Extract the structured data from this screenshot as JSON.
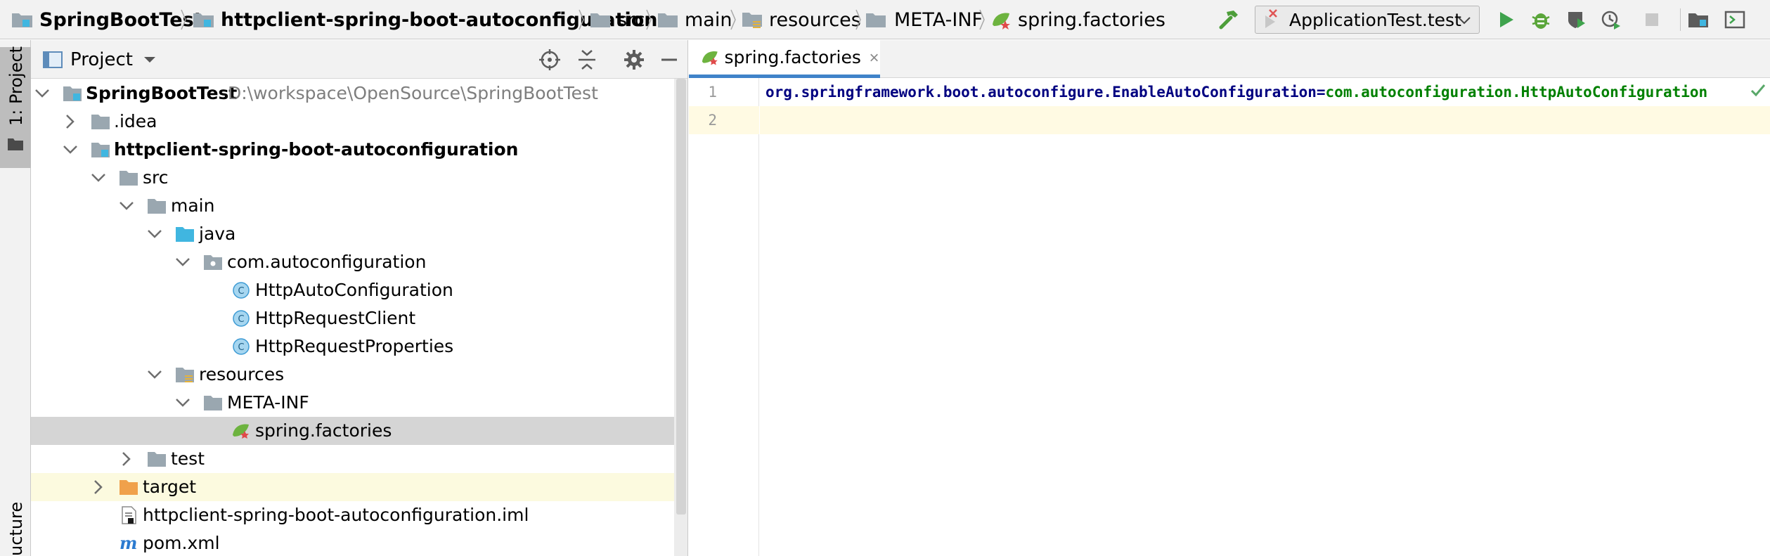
{
  "navbar": {
    "breadcrumbs": [
      {
        "label": "SpringBootTest",
        "icon": "folder-module-icon",
        "bold": true
      },
      {
        "label": "httpclient-spring-boot-autoconfiguration",
        "icon": "folder-module-icon",
        "bold": true
      },
      {
        "label": "src",
        "icon": "folder-icon"
      },
      {
        "label": "main",
        "icon": "folder-icon"
      },
      {
        "label": "resources",
        "icon": "resources-folder-icon"
      },
      {
        "label": "META-INF",
        "icon": "folder-icon"
      },
      {
        "label": "spring.factories",
        "icon": "spring-factories-icon"
      }
    ],
    "run_config": "ApplicationTest.test",
    "toolbar_icons": [
      "build-hammer-icon",
      "run-icon",
      "debug-icon",
      "coverage-icon",
      "profile-icon",
      "stop-icon",
      "project-structure-icon",
      "terminal-icon"
    ]
  },
  "left_strip": {
    "project_tab": "1: Project",
    "structure_tab": "ucture"
  },
  "project_panel": {
    "title": "Project",
    "tree": [
      {
        "label": "SpringBootTest",
        "path": "D:\\workspace\\OpenSource\\SpringBootTest",
        "bold": true,
        "icon": "module-folder-icon",
        "expanded": true,
        "depth": 0
      },
      {
        "label": ".idea",
        "icon": "folder-icon",
        "expanded": false,
        "depth": 1
      },
      {
        "label": "httpclient-spring-boot-autoconfiguration",
        "bold": true,
        "icon": "module-folder-icon",
        "expanded": true,
        "depth": 1
      },
      {
        "label": "src",
        "icon": "folder-icon",
        "expanded": true,
        "depth": 2
      },
      {
        "label": "main",
        "icon": "folder-icon",
        "expanded": true,
        "depth": 3
      },
      {
        "label": "java",
        "icon": "source-folder-icon",
        "expanded": true,
        "depth": 4
      },
      {
        "label": "com.autoconfiguration",
        "icon": "package-icon",
        "expanded": true,
        "depth": 5
      },
      {
        "label": "HttpAutoConfiguration",
        "icon": "class-icon",
        "depth": 6
      },
      {
        "label": "HttpRequestClient",
        "icon": "class-icon",
        "depth": 6
      },
      {
        "label": "HttpRequestProperties",
        "icon": "class-icon",
        "depth": 6
      },
      {
        "label": "resources",
        "icon": "resources-folder-icon",
        "expanded": true,
        "depth": 4
      },
      {
        "label": "META-INF",
        "icon": "folder-icon",
        "expanded": true,
        "depth": 5
      },
      {
        "label": "spring.factories",
        "icon": "spring-factories-icon",
        "depth": 6,
        "selected": true
      },
      {
        "label": "test",
        "icon": "folder-icon",
        "expanded": false,
        "depth": 3
      },
      {
        "label": "target",
        "icon": "excluded-folder-icon",
        "expanded": false,
        "depth": 2,
        "excluded": true
      },
      {
        "label": "httpclient-spring-boot-autoconfiguration.iml",
        "icon": "iml-file-icon",
        "depth": 2
      },
      {
        "label": "pom.xml",
        "icon": "maven-icon",
        "depth": 2
      }
    ]
  },
  "editor": {
    "tab_label": "spring.factories",
    "line_numbers": [
      "1",
      "2"
    ],
    "code": {
      "key": "org.springframework.boot.autoconfigure.EnableAutoConfiguration",
      "eq": "=",
      "value": "com.autoconfiguration.HttpAutoConfiguration"
    }
  },
  "colors": {
    "accent": "#4083c9",
    "selected_row": "#d5d5d5",
    "current_line": "#fffae3",
    "key_color": "#000080",
    "value_color": "#008000"
  }
}
